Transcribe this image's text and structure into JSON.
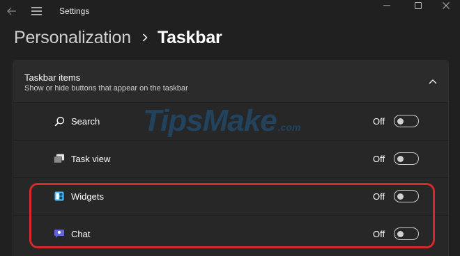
{
  "window": {
    "app_title": "Settings"
  },
  "breadcrumb": {
    "parent": "Personalization",
    "current": "Taskbar"
  },
  "section": {
    "title": "Taskbar items",
    "subtitle": "Show or hide buttons that appear on the taskbar",
    "expanded": true,
    "items": [
      {
        "label": "Search",
        "icon": "search-icon",
        "state": "Off",
        "on": false
      },
      {
        "label": "Task view",
        "icon": "task-view-icon",
        "state": "Off",
        "on": false
      },
      {
        "label": "Widgets",
        "icon": "widgets-icon",
        "state": "Off",
        "on": false
      },
      {
        "label": "Chat",
        "icon": "chat-icon",
        "state": "Off",
        "on": false
      }
    ]
  },
  "watermark": {
    "main": "TipsMake",
    "suffix": ".com"
  },
  "colors": {
    "background": "#202020",
    "card": "#272727",
    "highlight": "#d5282f",
    "widgets_blue": "#4cc2ff",
    "chat_purple": "#6264d9"
  }
}
